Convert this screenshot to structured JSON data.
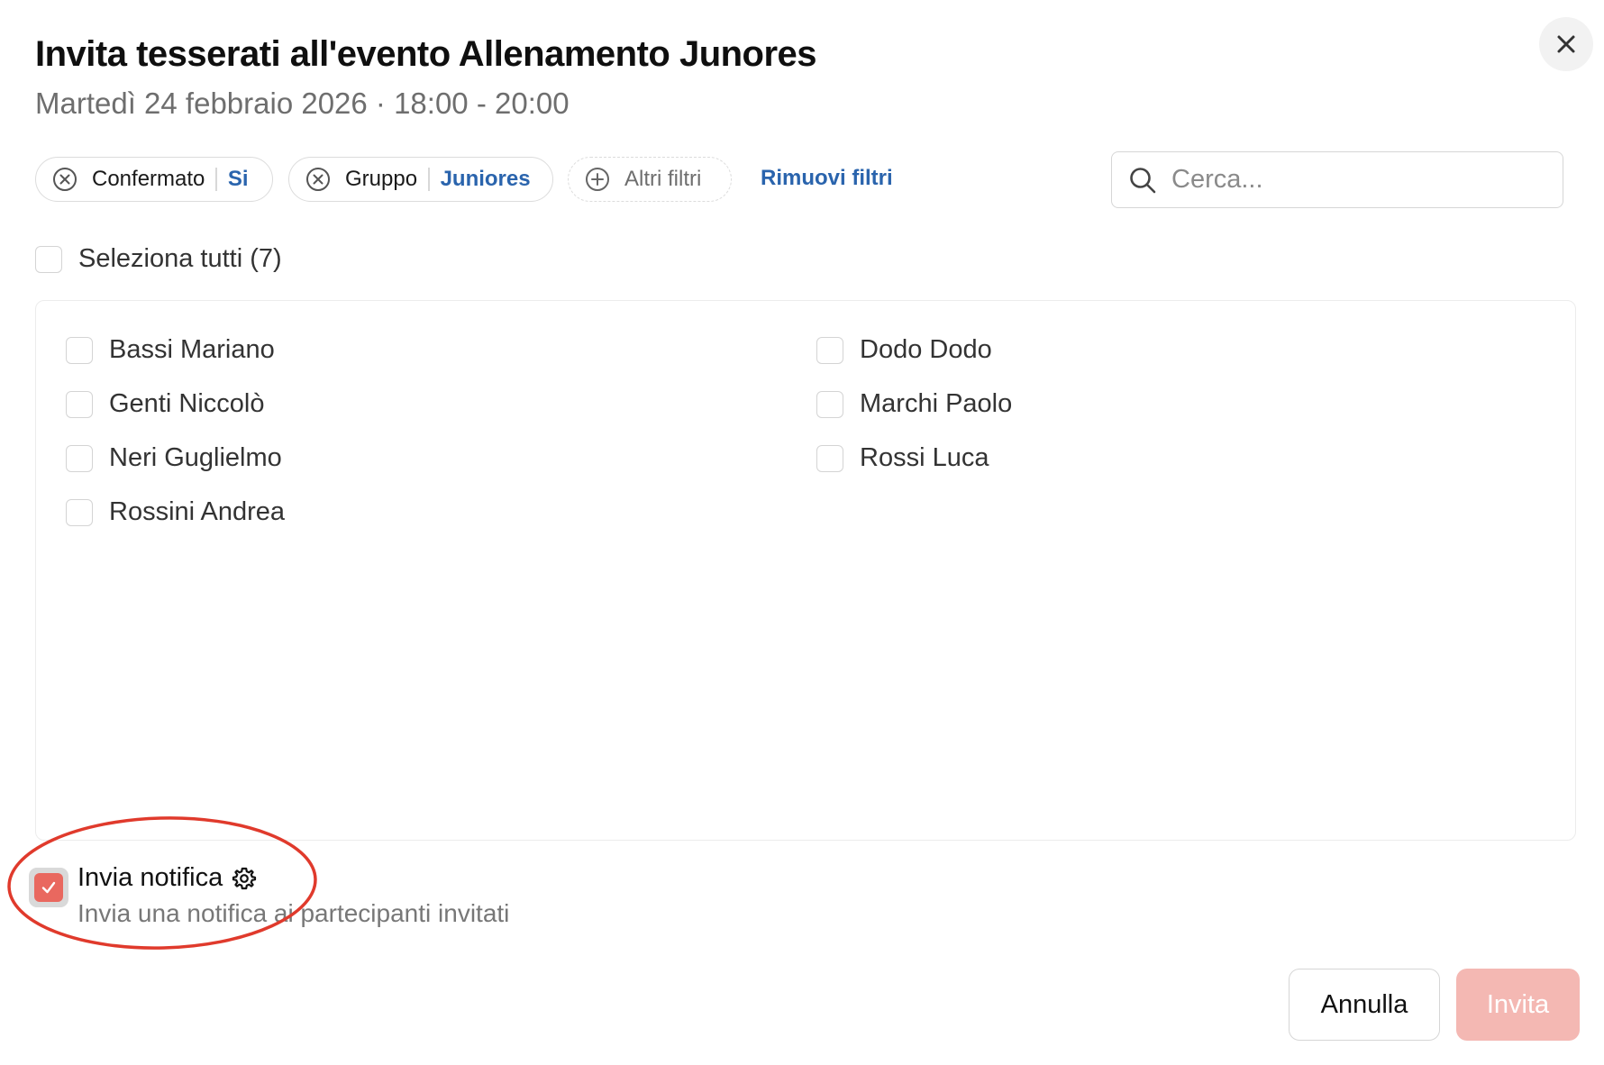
{
  "dialog": {
    "title": "Invita tesserati all'evento Allenamento Junores",
    "subtitle": "Martedì 24 febbraio 2026 · 18:00 - 20:00",
    "close_icon": "close-icon"
  },
  "filters": {
    "chips": [
      {
        "label": "Confermato",
        "value": "Si",
        "icon": "remove-filter-icon"
      },
      {
        "label": "Gruppo",
        "value": "Juniores",
        "icon": "remove-filter-icon"
      }
    ],
    "more_filters": {
      "label": "Altri filtri",
      "icon": "add-filter-icon"
    },
    "remove_filters_label": "Rimuovi filtri"
  },
  "search": {
    "placeholder": "Cerca...",
    "value": "",
    "icon": "search-icon"
  },
  "select_all": {
    "label": "Seleziona tutti (7)",
    "checked": false
  },
  "members": [
    {
      "name": "Bassi Mariano",
      "checked": false
    },
    {
      "name": "Dodo Dodo",
      "checked": false
    },
    {
      "name": "Genti Niccolò",
      "checked": false
    },
    {
      "name": "Marchi Paolo",
      "checked": false
    },
    {
      "name": "Neri Guglielmo",
      "checked": false
    },
    {
      "name": "Rossi Luca",
      "checked": false
    },
    {
      "name": "Rossini Andrea",
      "checked": false
    }
  ],
  "notification": {
    "title": "Invia notifica",
    "description": "Invia una notifica ai partecipanti invitati",
    "checked": true,
    "settings_icon": "gear-icon"
  },
  "actions": {
    "cancel_label": "Annulla",
    "invite_label": "Invita"
  },
  "colors": {
    "accent_link": "#2a64ad",
    "checkbox_checked": "#e9685f",
    "invite_disabled": "#f4b8b3",
    "annotation": "#e03a2c"
  }
}
